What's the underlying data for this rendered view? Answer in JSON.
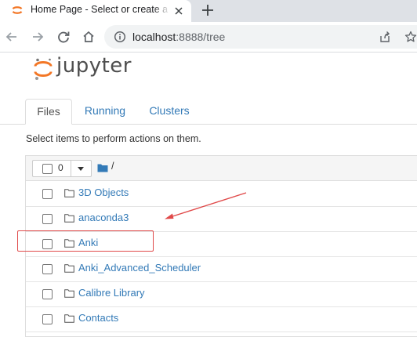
{
  "browser": {
    "tab_title": "Home Page - Select or create a notebook",
    "url_host": "localhost",
    "url_rest": ":8888/tree"
  },
  "jupyter": {
    "logo_text": "jupyter",
    "tabs": [
      {
        "label": "Files",
        "active": true
      },
      {
        "label": "Running",
        "active": false
      },
      {
        "label": "Clusters",
        "active": false
      }
    ],
    "hint": "Select items to perform actions on them.",
    "selected_count": "0",
    "path": "/",
    "items": [
      {
        "name": "3D Objects",
        "type": "folder"
      },
      {
        "name": "anaconda3",
        "type": "folder"
      },
      {
        "name": "Anki",
        "type": "folder",
        "highlighted": true
      },
      {
        "name": "Anki_Advanced_Scheduler",
        "type": "folder"
      },
      {
        "name": "Calibre Library",
        "type": "folder"
      },
      {
        "name": "Contacts",
        "type": "folder"
      }
    ]
  },
  "colors": {
    "link": "#337ab7",
    "jupyter_orange": "#f37726",
    "annotation_red": "#e04a4a"
  }
}
